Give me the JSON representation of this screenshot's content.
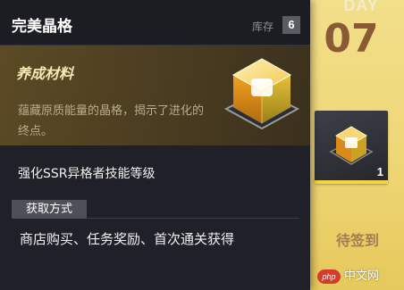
{
  "background": {
    "day_label": "DAY",
    "day_number": "07",
    "reward_quantity": "1",
    "status_text": "待签到"
  },
  "tooltip": {
    "item_title": "完美晶格",
    "stock_label": "库存",
    "stock_count": "6",
    "category_label": "养成材料",
    "description": "蕴藏原质能量的晶格，揭示了进化的终点。",
    "effect_text": "强化SSR异格者技能等级",
    "obtain_label": "获取方式",
    "source_text": "商店购买、任务奖励、首次通关获得",
    "item_icon": "crystal-cube-icon"
  },
  "watermark": {
    "logo_text": "php",
    "site_text": "中文网"
  },
  "colors": {
    "panel_bg": "#202128",
    "feature_bg": "#5b4a25",
    "accent_gold": "#f3d543",
    "calendar_bg": "#efd676"
  }
}
